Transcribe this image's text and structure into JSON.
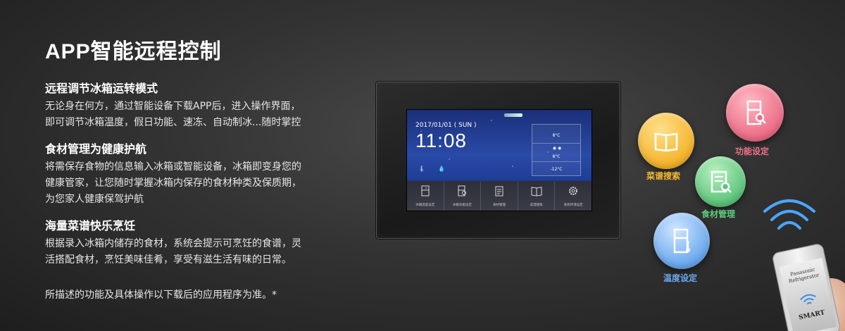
{
  "page": {
    "title": "APP智能远程控制",
    "note": "所描述的功能及具体操作以下载后的应用程序为准。*"
  },
  "features": [
    {
      "title": "远程调节冰箱运转模式",
      "lines": [
        "无论身在何方，通过智能设备下载APP后，进入操作界面，",
        "即可调节冰箱温度，假日功能、速冻、自动制冰...随时掌控"
      ]
    },
    {
      "title": "食材管理为健康护航",
      "lines": [
        "将需保存食物的信息输入冰箱或智能设备，冰箱即变身您的",
        "健康管家，让您随时掌握冰箱内保存的食材种类及保质期，",
        "为您家人健康保驾护航"
      ]
    },
    {
      "title": "海量菜谱快乐烹饪",
      "lines": [
        "根据录入冰箱内储存的食材，系统会提示可烹饪的食谱，灵",
        "活搭配食材，烹饪美味佳肴，享受有滋生活有味的日常。"
      ]
    }
  ],
  "panel": {
    "date": "2017/01/01 ( SUN )",
    "time": "11:08",
    "temps": {
      "top": "8°C",
      "middle": "8°C",
      "bottom": "-12°C"
    },
    "menu": [
      {
        "label": "冰箱温度设定",
        "icon": "fridge-temp-icon"
      },
      {
        "label": "冰箱功能设定",
        "icon": "fridge-search-icon"
      },
      {
        "label": "食材管理",
        "icon": "clipboard-icon"
      },
      {
        "label": "菜谱搜索",
        "icon": "book-icon"
      },
      {
        "label": "系统环境设定",
        "icon": "gear-icon"
      }
    ]
  },
  "bubbles": {
    "recipe": {
      "label": "菜谱搜索",
      "color": "#f4b32a"
    },
    "function": {
      "label": "功能设定",
      "color": "#ec6c86"
    },
    "food": {
      "label": "食材管理",
      "color": "#5dc47a"
    },
    "temperature": {
      "label": "温度设定",
      "color": "#6aa8ee"
    }
  },
  "phone": {
    "brand_line1": "Panasonic",
    "brand_line2": "Refrigerator",
    "smart": "SMART"
  }
}
